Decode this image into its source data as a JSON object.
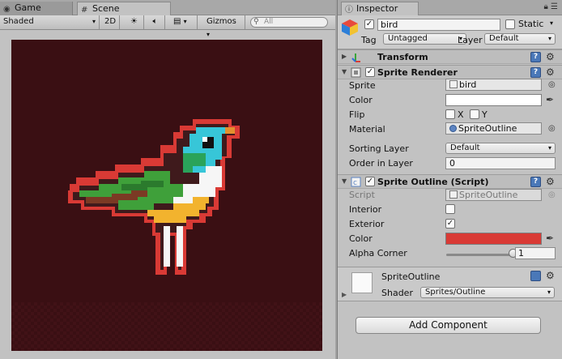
{
  "scene": {
    "tabs": {
      "game": "Game",
      "scene": "Scene"
    },
    "toolbar": {
      "draw_mode": "Shaded",
      "mode_2d": "2D",
      "gizmos": "Gizmos",
      "search_placeholder": "All"
    },
    "viewport_bg": "#3a0f13"
  },
  "inspector": {
    "tab_label": "Inspector",
    "game_object": {
      "active": true,
      "name": "bird",
      "static_label": "Static",
      "static": false,
      "tag_label": "Tag",
      "tag": "Untagged",
      "layer_label": "Layer",
      "layer": "Default"
    },
    "transform": {
      "title": "Transform"
    },
    "sprite_renderer": {
      "title": "Sprite Renderer",
      "enabled": true,
      "sprite_label": "Sprite",
      "sprite": "bird",
      "color_label": "Color",
      "color": "#ffffff",
      "flip_label": "Flip",
      "flip_x": "X",
      "flip_y": "Y",
      "material_label": "Material",
      "material": "SpriteOutline",
      "sorting_layer_label": "Sorting Layer",
      "sorting_layer": "Default",
      "order_label": "Order in Layer",
      "order": "0"
    },
    "sprite_outline": {
      "title": "Sprite Outline (Script)",
      "enabled": true,
      "script_label": "Script",
      "script": "SpriteOutline",
      "interior_label": "Interior",
      "interior": false,
      "exterior_label": "Exterior",
      "exterior": true,
      "color_label": "Color",
      "color": "#d93a35",
      "alpha_corner_label": "Alpha Corner",
      "alpha_corner": "1",
      "alpha_corner_fraction": 1.0
    },
    "material": {
      "name": "SpriteOutline",
      "shader_label": "Shader",
      "shader": "Sprites/Outline"
    },
    "add_component_label": "Add Component"
  },
  "icons": [
    "game-tab-icon",
    "scene-tab-icon",
    "inspector-tab-icon",
    "lock-icon",
    "menu-icon",
    "cube-icon",
    "transform-icon",
    "sprite-renderer-icon",
    "script-icon",
    "help-icon",
    "gear-icon",
    "eyedropper-icon",
    "search-icon",
    "sun-icon",
    "speaker-icon",
    "image-icon"
  ]
}
